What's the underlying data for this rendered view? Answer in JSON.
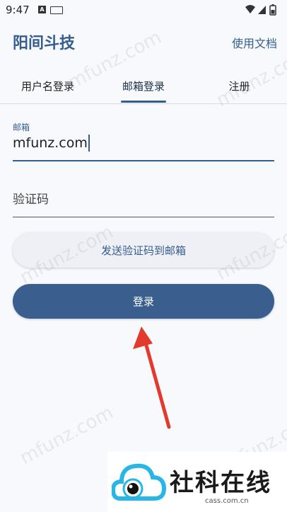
{
  "status_bar": {
    "time": "9:47",
    "notif_letter": "A"
  },
  "app": {
    "title": "阳间斗技",
    "docs_link": "使用文档"
  },
  "tabs": [
    {
      "label": "用户名登录"
    },
    {
      "label": "邮箱登录",
      "selected": true
    },
    {
      "label": "注册"
    }
  ],
  "email": {
    "label": "邮箱",
    "value": "mfunz.com"
  },
  "code": {
    "label": "验证码"
  },
  "buttons": {
    "send_code": "发送验证码到邮箱",
    "login": "登录"
  },
  "watermark": {
    "text": "mfunz.com"
  },
  "logo": {
    "name": "社科在线",
    "domain": "cass.com.cn"
  },
  "colors": {
    "primary": "#355d8d",
    "background": "#f8f9fd",
    "arrow": "#e23b2e",
    "logo_cyan": "#27b6e6"
  }
}
